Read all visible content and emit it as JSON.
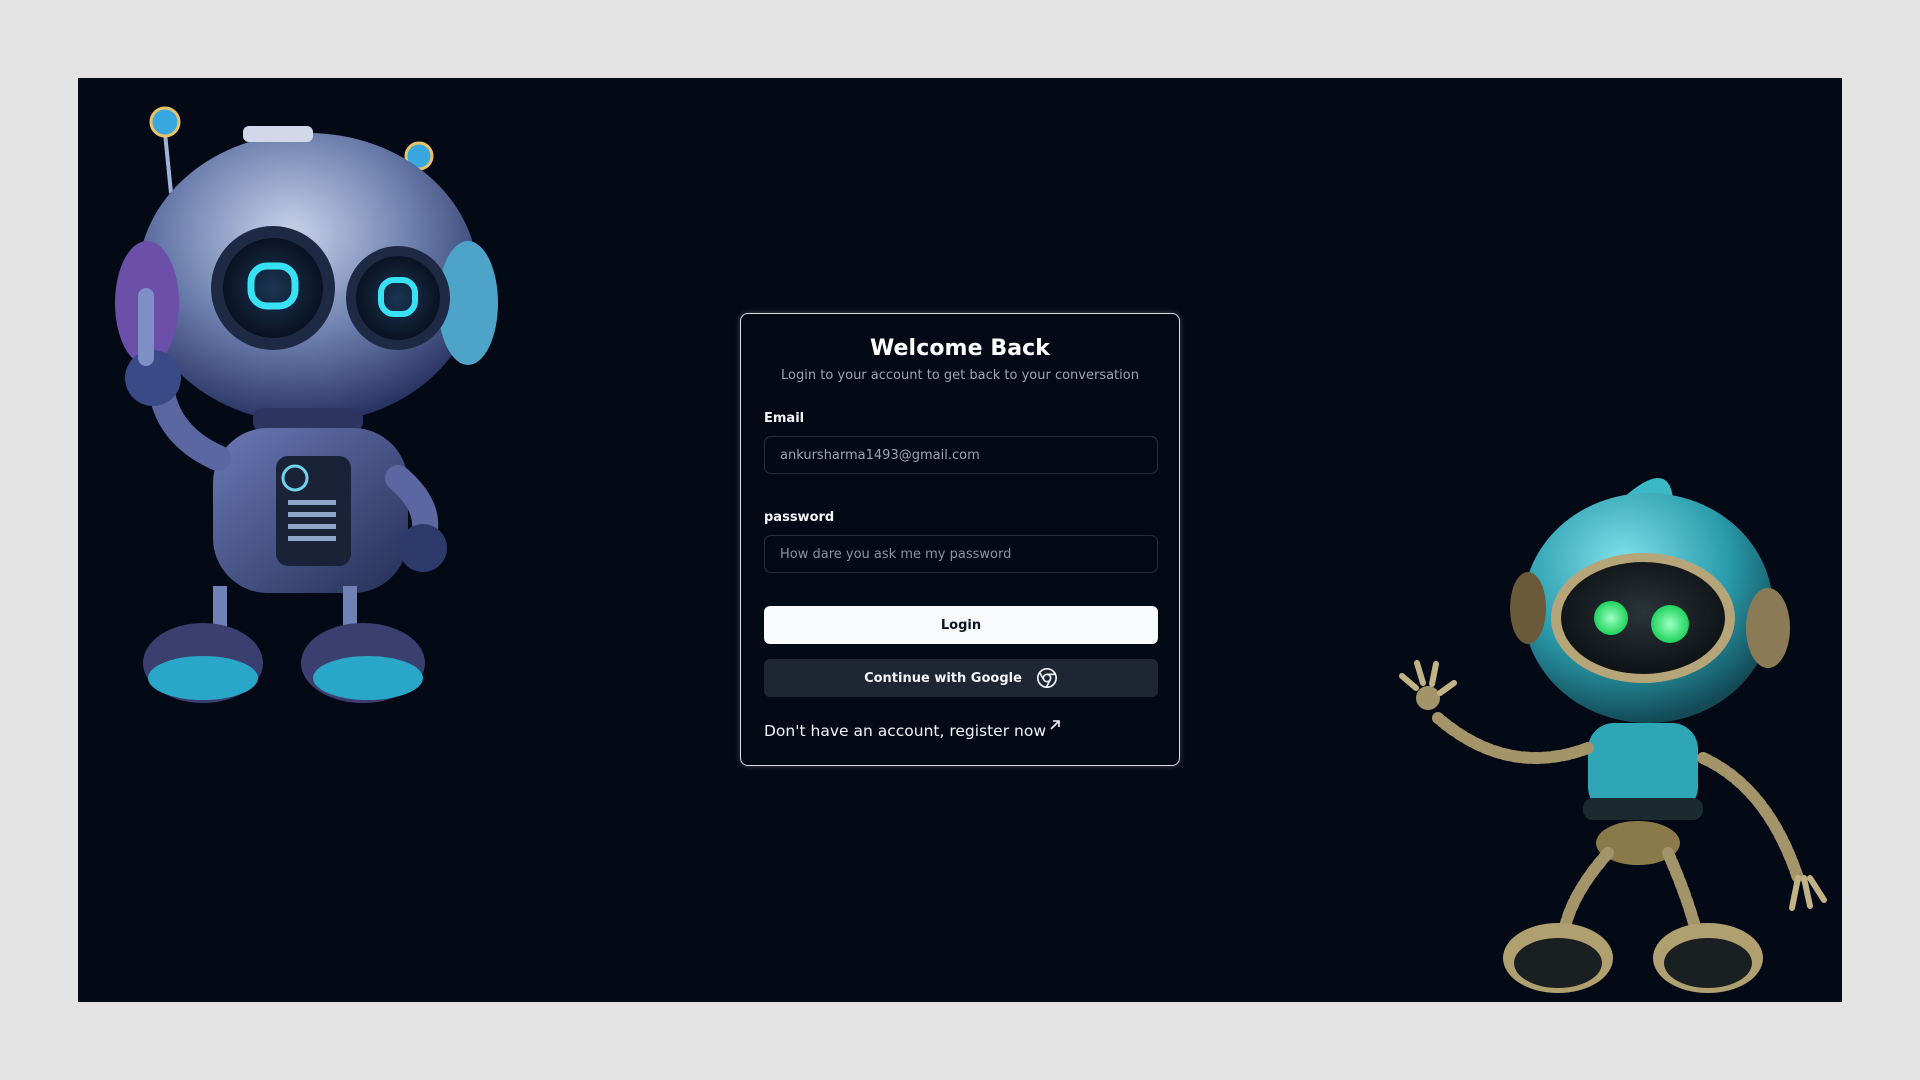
{
  "login_card": {
    "title": "Welcome Back",
    "subtitle": "Login to your account to get back to your conversation",
    "email": {
      "label": "Email",
      "value": "ankursharma1493@gmail.com",
      "placeholder": ""
    },
    "password": {
      "label": "password",
      "value": "",
      "placeholder": "How dare you ask me my password"
    },
    "login_button": "Login",
    "google_button": "Continue with Google",
    "register_prompt": "Don't have an account, register now",
    "icons": {
      "google": "chrome-icon",
      "register": "arrow-up-right-icon"
    }
  },
  "colors": {
    "page_background": "#e3e3e4",
    "app_background": "#040916",
    "card_border": "#d8dbe2",
    "login_button_bg": "#f8fafc",
    "google_button_bg": "#1f2633",
    "robot_accent": "#2fd3ee",
    "robot_eyes_green": "#35f07a"
  },
  "illustrations": [
    "robot-left-illustration",
    "robot-right-illustration"
  ]
}
